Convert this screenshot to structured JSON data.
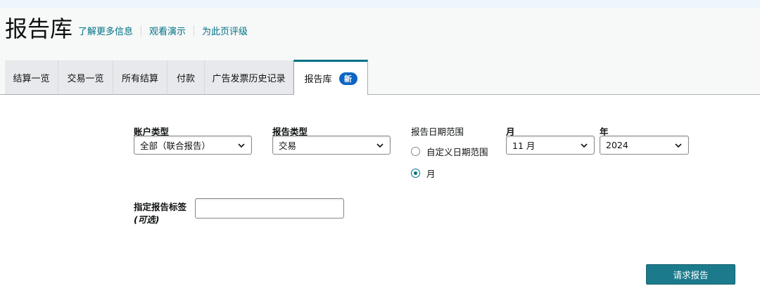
{
  "header": {
    "title": "报告库",
    "links": [
      "了解更多信息",
      "观看演示",
      "为此页评级"
    ]
  },
  "tabs": [
    {
      "label": "结算一览"
    },
    {
      "label": "交易一览"
    },
    {
      "label": "所有结算"
    },
    {
      "label": "付款"
    },
    {
      "label": "广告发票历史记录"
    },
    {
      "label": "报告库",
      "badge": "新",
      "active": true
    }
  ],
  "form": {
    "account_type": {
      "label": "账户类型",
      "value": "全部（联合报告）"
    },
    "report_type": {
      "label": "报告类型",
      "value": "交易"
    },
    "date_range": {
      "label": "报告日期范围",
      "options": [
        {
          "label": "自定义日期范围",
          "checked": false
        },
        {
          "label": "月",
          "checked": true
        }
      ]
    },
    "month": {
      "label": "月",
      "value": "11 月"
    },
    "year": {
      "label": "年",
      "value": "2024"
    },
    "tag": {
      "label": "指定报告标签",
      "optional": "(可选)",
      "value": ""
    },
    "submit_label": "请求报告"
  },
  "colors": {
    "accent": "#007185",
    "button": "#1b7b8c",
    "badge": "#0e65c5",
    "header_bg": "#f7f8f8"
  },
  "icons": {
    "select_arrow": "chevron-down-icon"
  }
}
